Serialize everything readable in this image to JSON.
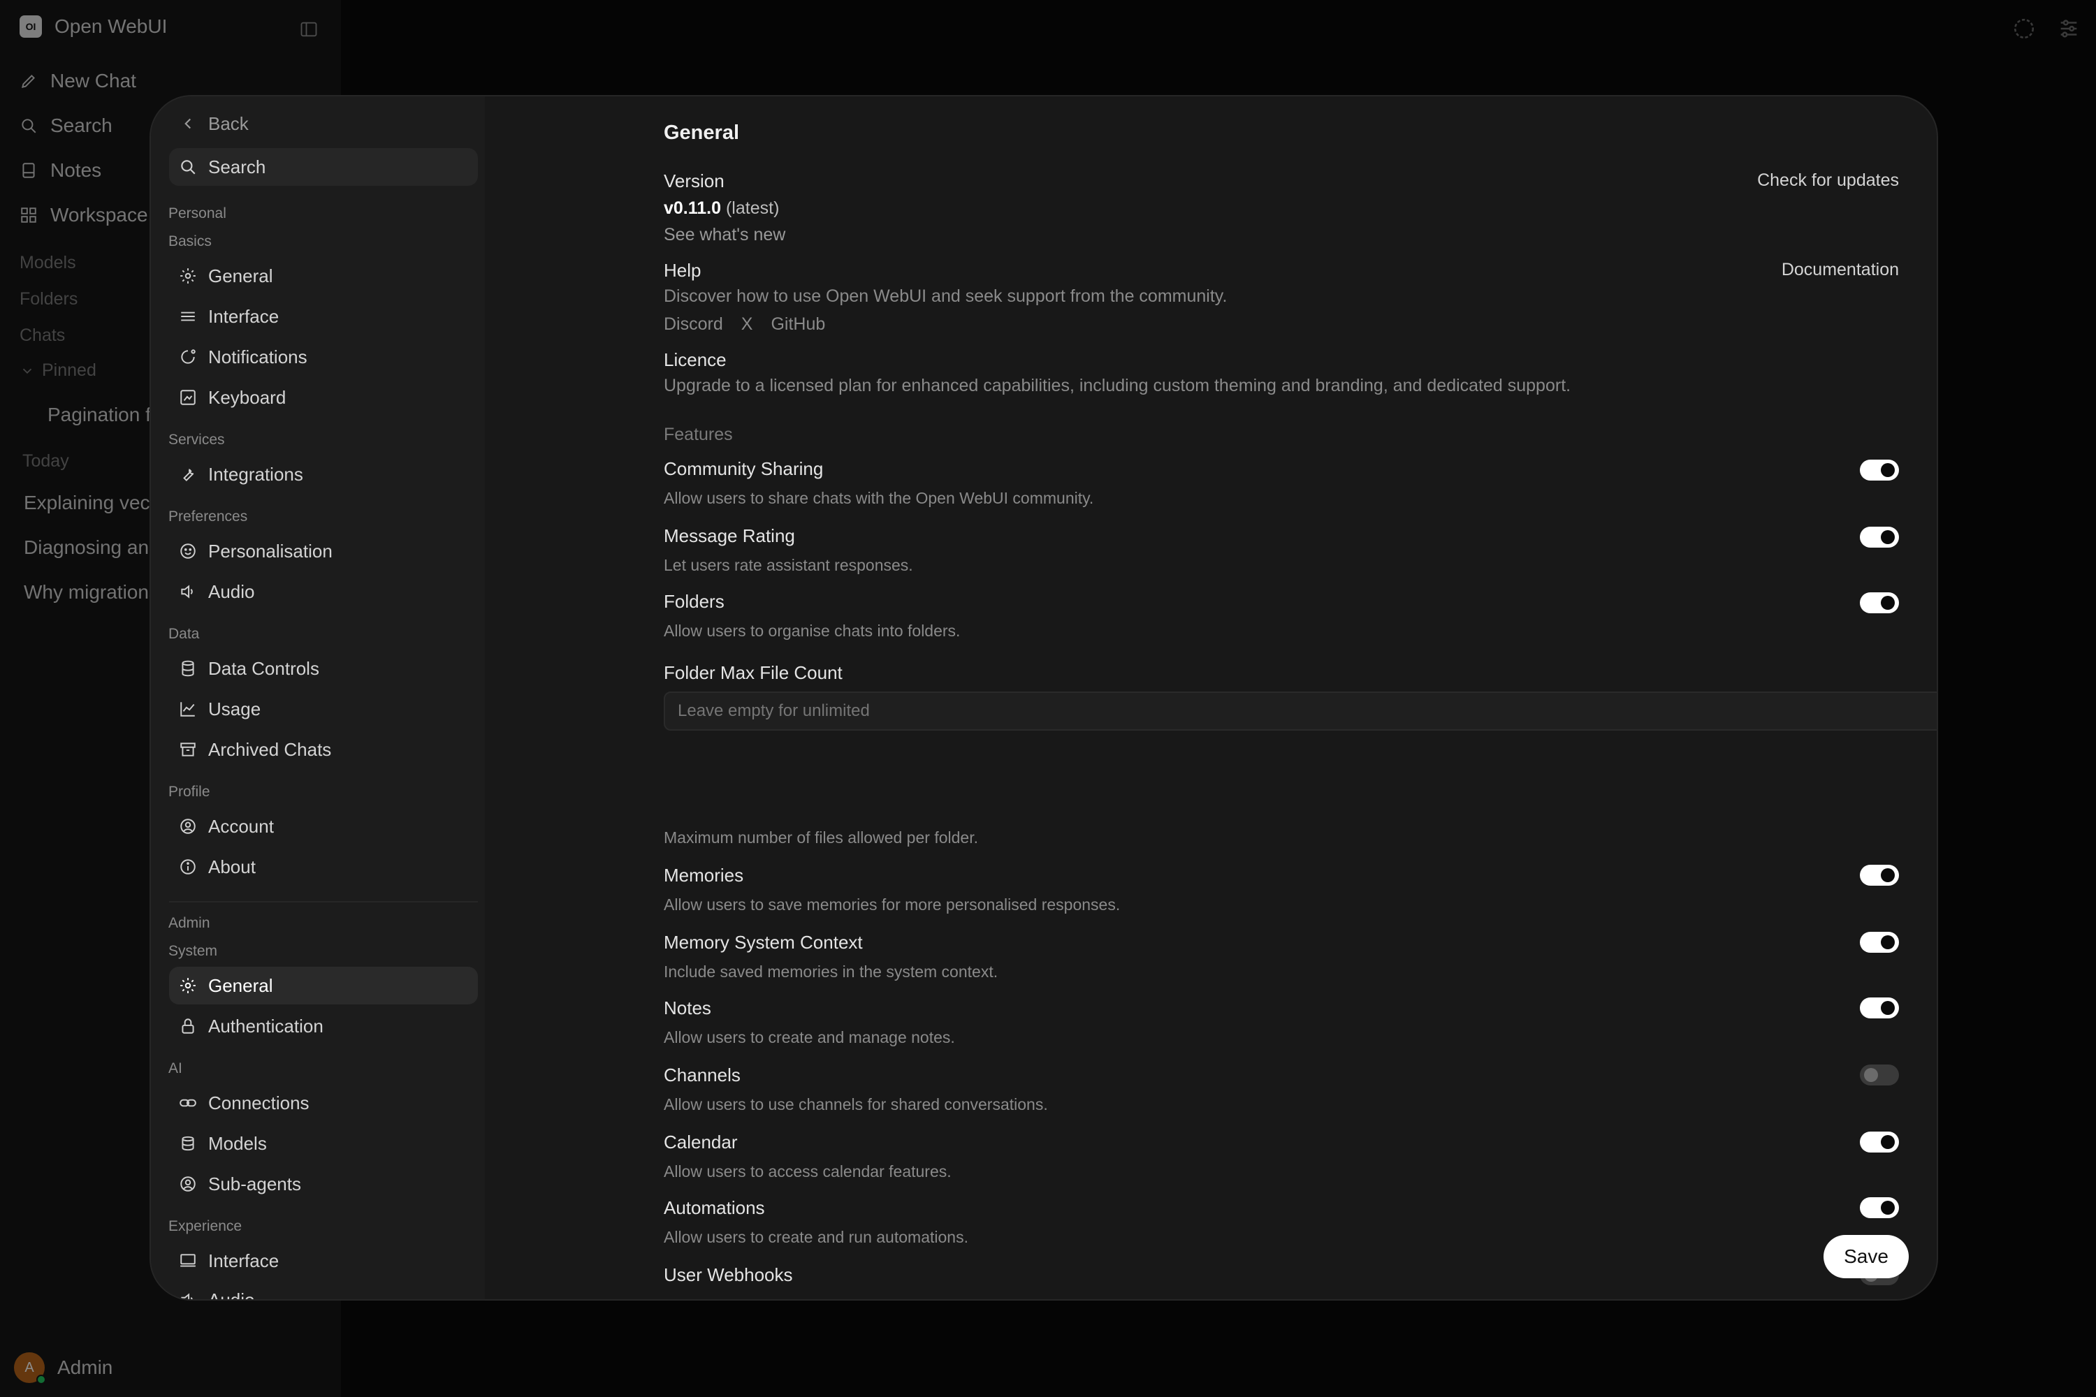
{
  "app": {
    "title": "Open WebUI",
    "logo_text": "OI",
    "nav": {
      "new_chat": "New Chat",
      "search": "Search",
      "notes": "Notes",
      "workspace": "Workspace"
    },
    "sections": {
      "models": "Models",
      "folders": "Folders",
      "chats": "Chats",
      "pinned": "Pinned",
      "today": "Today"
    },
    "pinned_chats": [
      "Pagination f"
    ],
    "today_chats": [
      "Explaining vect",
      "Diagnosing an",
      "Why migrations"
    ],
    "user": {
      "name": "Admin",
      "avatar_letter": "A"
    }
  },
  "settings_nav": {
    "back": "Back",
    "search": "Search",
    "personal_label": "Personal",
    "groups": [
      {
        "label": "Basics",
        "items": [
          "General",
          "Interface",
          "Notifications",
          "Keyboard"
        ]
      },
      {
        "label": "Services",
        "items": [
          "Integrations"
        ]
      },
      {
        "label": "Preferences",
        "items": [
          "Personalisation",
          "Audio"
        ]
      },
      {
        "label": "Data",
        "items": [
          "Data Controls",
          "Usage",
          "Archived Chats"
        ]
      },
      {
        "label": "Profile",
        "items": [
          "Account",
          "About"
        ]
      }
    ],
    "admin_label": "Admin",
    "admin_groups": [
      {
        "label": "System",
        "items": [
          "General",
          "Authentication"
        ]
      },
      {
        "label": "AI",
        "items": [
          "Connections",
          "Models",
          "Sub-agents"
        ]
      },
      {
        "label": "Experience",
        "items": [
          "Interface",
          "Audio"
        ]
      }
    ],
    "active": "admin-general"
  },
  "general": {
    "title": "General",
    "version": {
      "label": "Version",
      "value": "v0.11.0",
      "tag": "(latest)",
      "whats_new": "See what's new",
      "check_updates": "Check for updates"
    },
    "help": {
      "label": "Help",
      "desc": "Discover how to use Open WebUI and seek support from the community.",
      "links": [
        "Discord",
        "X",
        "GitHub"
      ],
      "documentation": "Documentation"
    },
    "licence": {
      "label": "Licence",
      "desc": "Upgrade to a licensed plan for enhanced capabilities, including custom theming and branding, and dedicated support."
    },
    "features_label": "Features",
    "features": [
      {
        "title": "Community Sharing",
        "desc": "Allow users to share chats with the Open WebUI community.",
        "enabled": true
      },
      {
        "title": "Message Rating",
        "desc": "Let users rate assistant responses.",
        "enabled": true
      },
      {
        "title": "Folders",
        "desc": "Allow users to organise chats into folders.",
        "enabled": true
      }
    ],
    "folder_max": {
      "label": "Folder Max File Count",
      "placeholder": "Leave empty for unlimited",
      "value": "",
      "hint": "Maximum number of files allowed per folder."
    },
    "features_more": [
      {
        "title": "Memories",
        "desc": "Allow users to save memories for more personalised responses.",
        "enabled": true
      },
      {
        "title": "Memory System Context",
        "desc": "Include saved memories in the system context.",
        "enabled": true
      },
      {
        "title": "Notes",
        "desc": "Allow users to create and manage notes.",
        "enabled": true
      },
      {
        "title": "Channels",
        "desc": "Allow users to use channels for shared conversations.",
        "enabled": false
      },
      {
        "title": "Calendar",
        "desc": "Allow users to access calendar features.",
        "enabled": true
      },
      {
        "title": "Automations",
        "desc": "Allow users to create and run automations.",
        "enabled": true
      },
      {
        "title": "User Webhooks",
        "desc": "",
        "enabled": false
      }
    ],
    "save": "Save"
  }
}
